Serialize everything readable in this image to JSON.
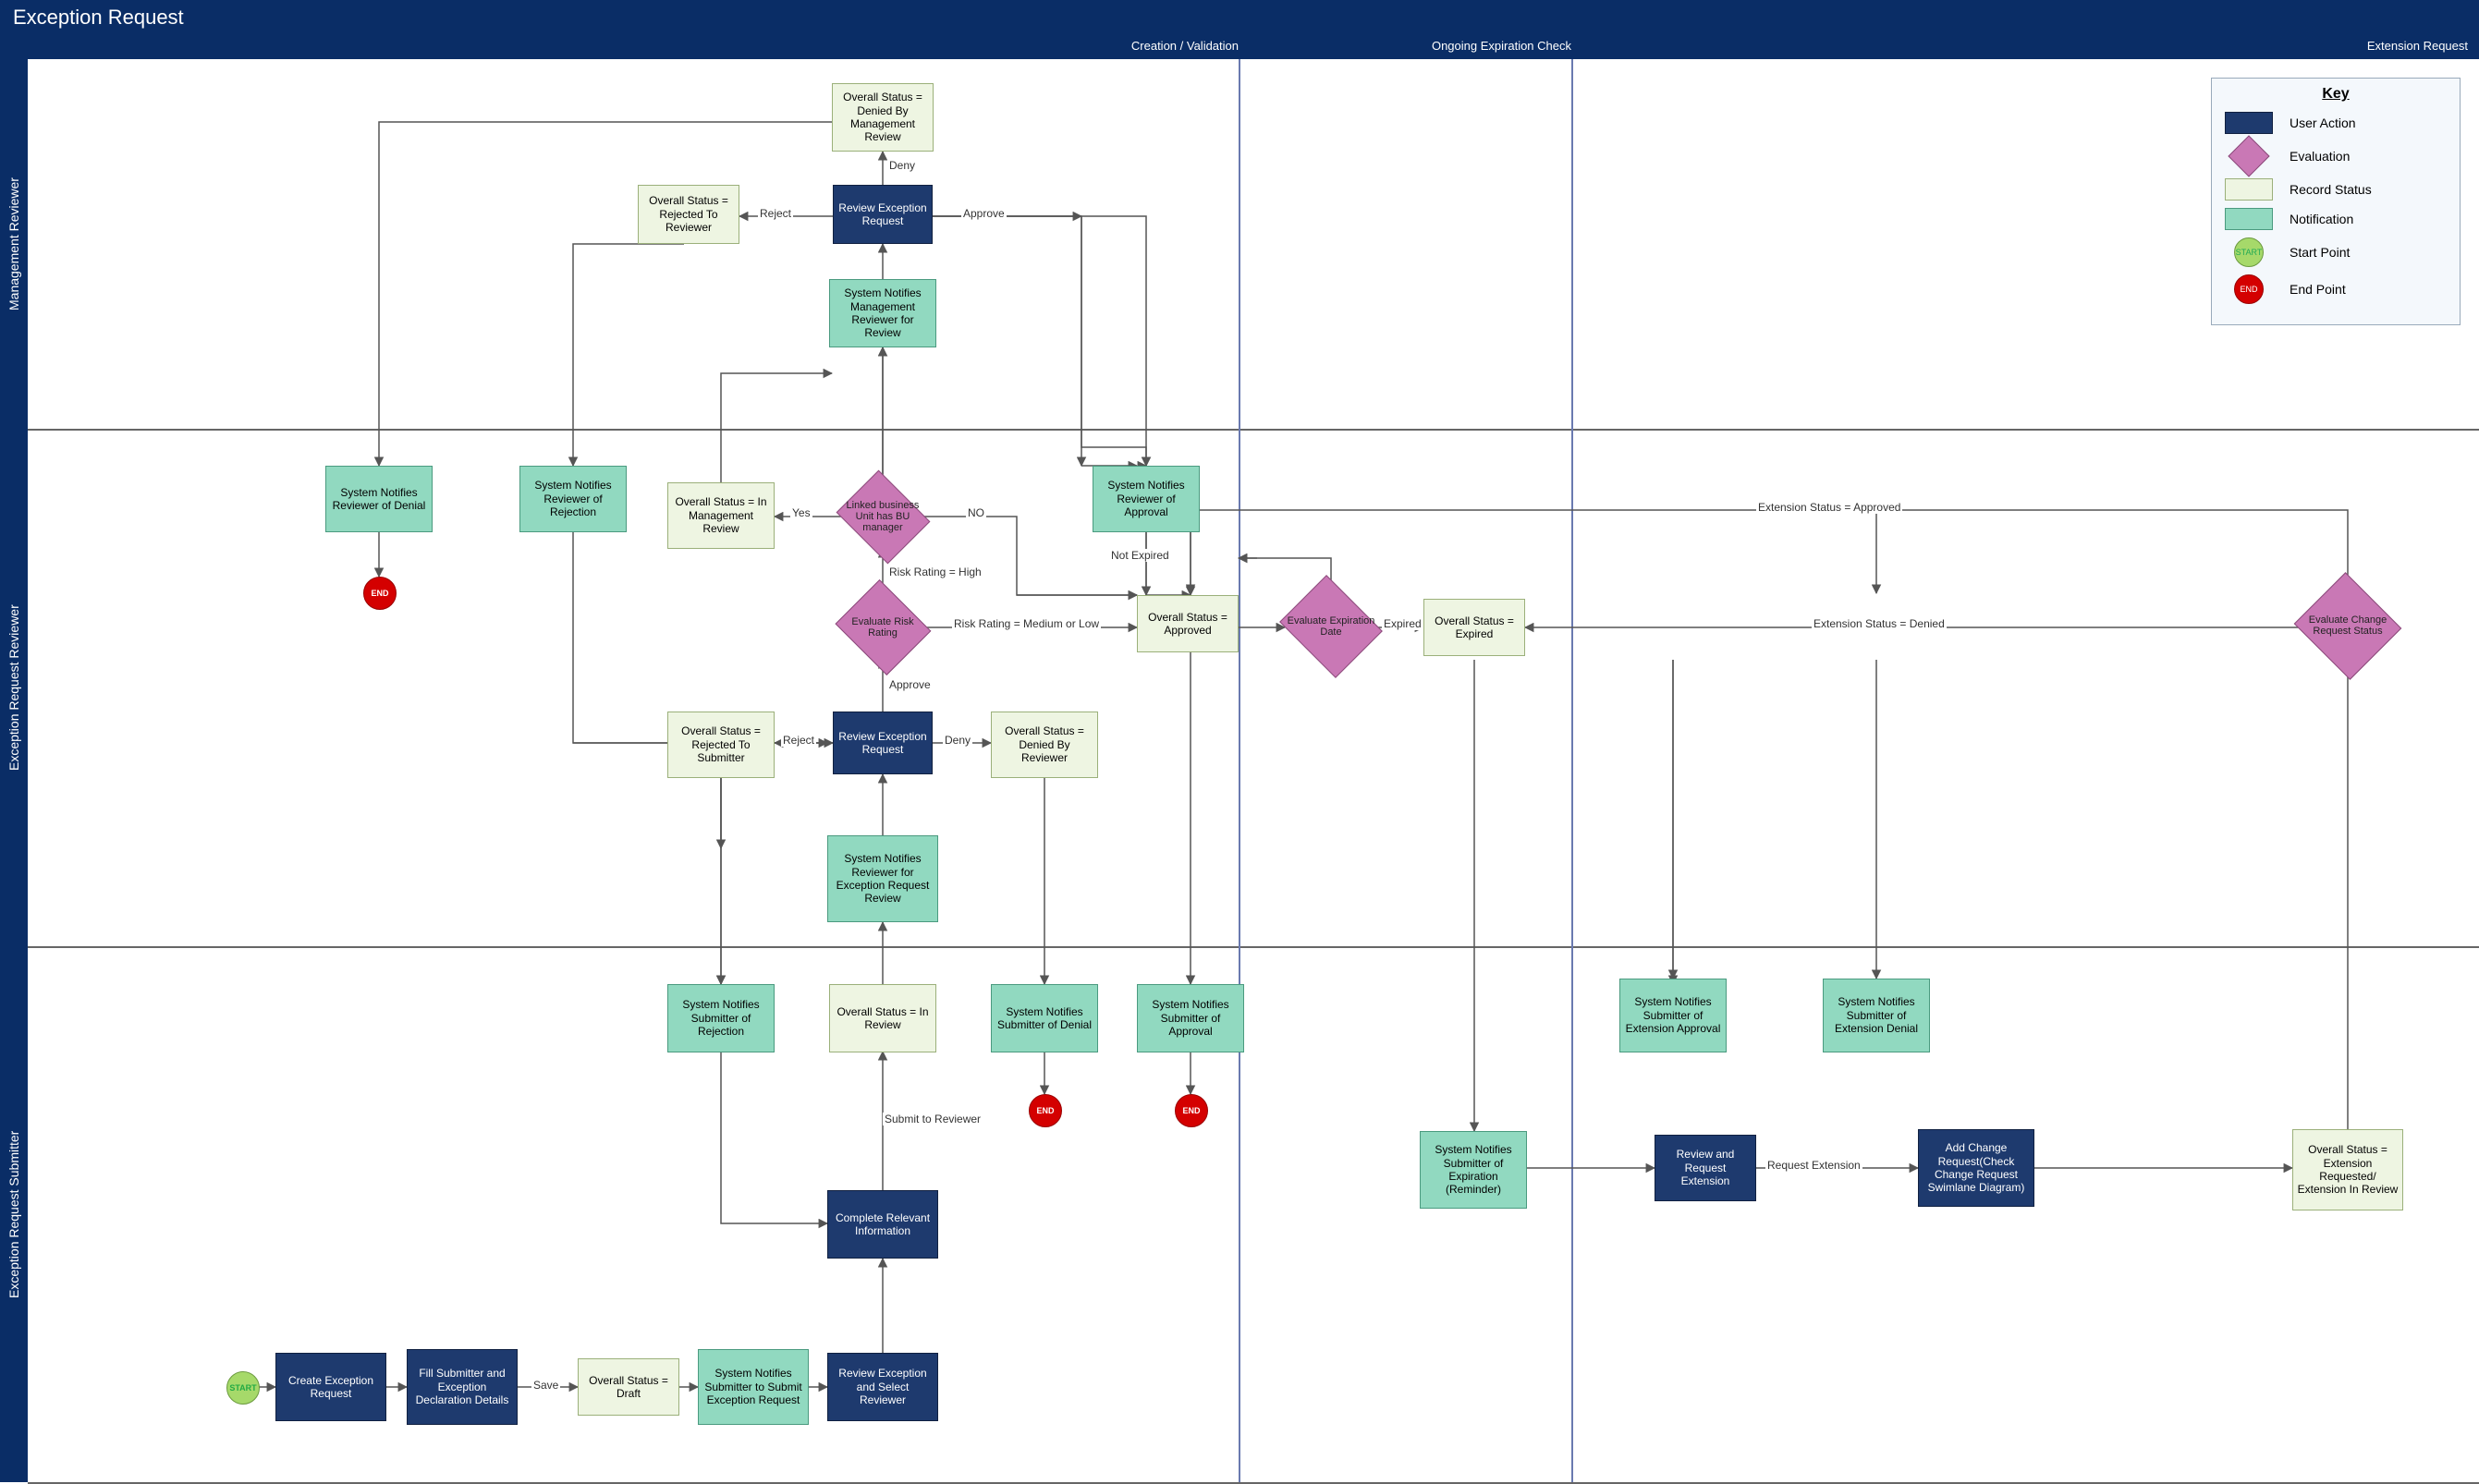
{
  "title": "Exception Request",
  "phases": {
    "creation": "Creation / Validation",
    "ongoing": "Ongoing Expiration Check",
    "extension": "Extension Request"
  },
  "swimlanes": {
    "mgmt": "Management Reviewer",
    "reviewer": "Exception Request Reviewer",
    "submitter": "Exception Request Submitter"
  },
  "key": {
    "title": "Key",
    "user_action": "User Action",
    "evaluation": "Evaluation",
    "record_status": "Record Status",
    "notification": "Notification",
    "start_point": "Start Point",
    "start_label": "START",
    "end_point": "End Point",
    "end_label": "END"
  },
  "nodes": {
    "start": "START",
    "create_exception": "Create Exception Request",
    "fill_details": "Fill Submitter and Exception Declaration Details",
    "status_draft": "Overall Status = Draft",
    "notify_submit": "System Notifies Submitter to Submit Exception Request",
    "review_select_reviewer": "Review Exception and Select Reviewer",
    "complete_info": "Complete Relevant Information",
    "status_in_review": "Overall Status = In Review",
    "notify_submitter_rejection": "System Notifies Submitter of Rejection",
    "notify_submitter_denial": "System Notifies Submitter of Denial",
    "notify_submitter_approval": "System Notifies Submitter of Approval",
    "notify_reviewer_for_review": "System Notifies Reviewer for Exception Request Review",
    "review_exception_reviewer": "Review Exception Request",
    "status_rejected_submitter": "Overall Status = Rejected To Submitter",
    "status_denied_reviewer": "Overall Status = Denied By Reviewer",
    "evaluate_risk": "Evaluate Risk Rating",
    "status_in_mgmt": "Overall Status = In Management Review",
    "bu_manager": "Linked business Unit has BU manager",
    "notify_mgmt": "System Notifies Management Reviewer for Review",
    "review_exception_mgmt": "Review Exception Request",
    "status_rejected_reviewer": "Overall Status = Rejected To Reviewer",
    "status_denied_mgmt": "Overall Status = Denied By Management Review",
    "notify_reviewer_approval": "System Notifies Reviewer of Approval",
    "notify_reviewer_denial": "System Notifies Reviewer of Denial",
    "notify_reviewer_rejection": "System Notifies Reviewer of Rejection",
    "status_approved": "Overall Status = Approved",
    "evaluate_expiration": "Evaluate Expiration Date",
    "status_expired": "Overall Status = Expired",
    "notify_submitter_expiration": "System Notifies Submitter of Expiration (Reminder)",
    "review_request_extension": "Review and Request Extension",
    "add_change_request": "Add Change Request(Check Change Request Swimlane Diagram)",
    "status_extension_requested": "Overall Status = Extension Requested/ Extension In Review",
    "evaluate_change_status": "Evaluate Change Request Status",
    "notify_submitter_ext_approval": "System Notifies Submitter of Extension Approval",
    "notify_submitter_ext_denial": "System Notifies Submitter of Extension Denial",
    "end": "END"
  },
  "edge_labels": {
    "save": "Save",
    "submit_reviewer": "Submit to Reviewer",
    "reject": "Reject",
    "deny": "Deny",
    "approve": "Approve",
    "risk_high": "Risk Rating = High",
    "risk_med_low": "Risk Rating = Medium or Low",
    "yes": "Yes",
    "no": "NO",
    "not_expired": "Not Expired",
    "expired": "Expired",
    "request_extension": "Request Extension",
    "ext_approved": "Extension Status = Approved",
    "ext_denied": "Extension Status = Denied"
  }
}
